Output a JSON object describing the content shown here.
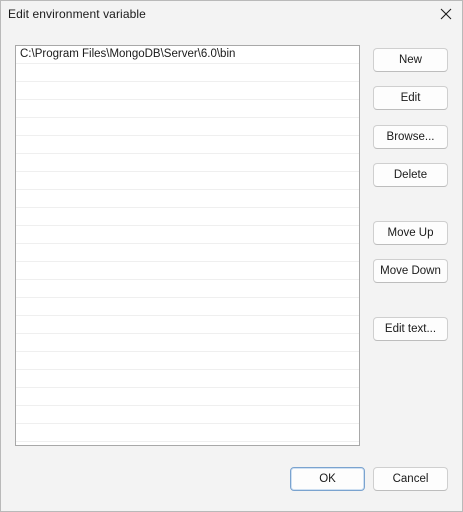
{
  "window": {
    "title": "Edit environment variable"
  },
  "list": {
    "entries": [
      "C:\\Program Files\\MongoDB\\Server\\6.0\\bin"
    ]
  },
  "buttons": {
    "new": "New",
    "edit": "Edit",
    "browse": "Browse...",
    "delete": "Delete",
    "move_up": "Move Up",
    "move_down": "Move Down",
    "edit_text": "Edit text...",
    "ok": "OK",
    "cancel": "Cancel"
  },
  "icons": {
    "close": "close-icon"
  },
  "colors": {
    "window_bg": "#f3f3f3",
    "list_bg": "#ffffff",
    "default_button_border": "#7aa3cf"
  }
}
